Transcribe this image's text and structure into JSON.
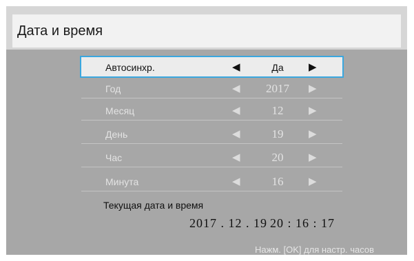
{
  "title": "Дата и время",
  "rows": [
    {
      "label": "Автосинхр.",
      "value": "Да"
    },
    {
      "label": "Год",
      "value": "2017"
    },
    {
      "label": "Месяц",
      "value": "12"
    },
    {
      "label": "День",
      "value": "19"
    },
    {
      "label": "Час",
      "value": "20"
    },
    {
      "label": "Минута",
      "value": "16"
    }
  ],
  "arrows": {
    "left": "◀",
    "right": "▶"
  },
  "current": {
    "label": "Текущая дата и время",
    "date": "2017 . 12 . 19",
    "time": "20 : 16 : 17"
  },
  "hint": "Нажм. [OK] для настр. часов",
  "colors": {
    "accent": "#3aa7df",
    "panel": "#a7a7a7",
    "header": "#f2f2f2"
  }
}
